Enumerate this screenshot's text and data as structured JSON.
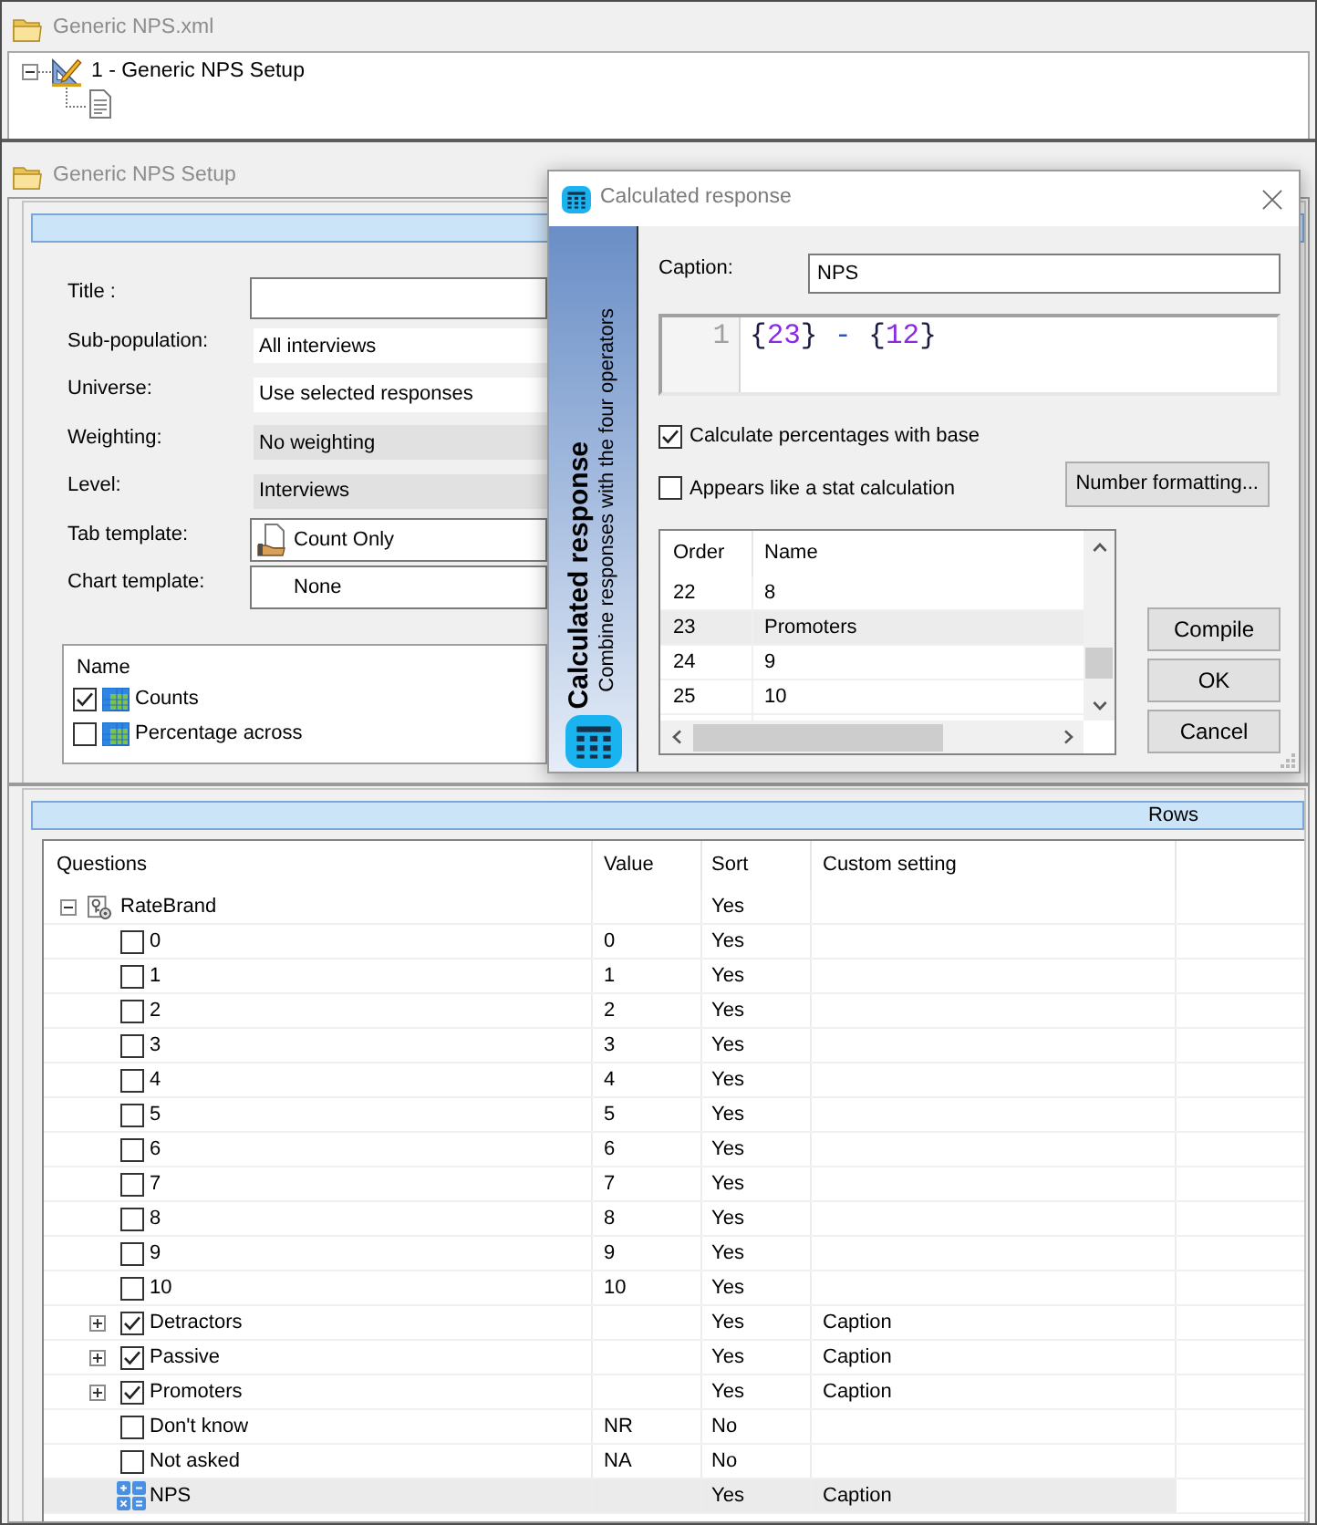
{
  "window": {
    "title": "Generic NPS.xml"
  },
  "tree": [
    {
      "kind": "setup",
      "label": "1 - Generic NPS Setup",
      "expanded": true,
      "children": [
        {
          "kind": "document"
        }
      ]
    }
  ],
  "setup": {
    "title": "Generic NPS Setup",
    "fields": [
      {
        "label": "Title :",
        "kind": "input"
      },
      {
        "label": "Sub-population:",
        "kind": "plain",
        "value": "All interviews"
      },
      {
        "label": "Universe:",
        "kind": "plain",
        "value": "Use selected responses"
      },
      {
        "label": "Weighting:",
        "kind": "readonly",
        "value": "No weighting"
      },
      {
        "label": "Level:",
        "kind": "readonly",
        "value": "Interviews"
      },
      {
        "label": "Tab template:",
        "kind": "template",
        "has_icon": true,
        "value": "Count Only"
      },
      {
        "label": "Chart template:",
        "kind": "template",
        "has_icon": false,
        "value": "None"
      }
    ],
    "table_list": {
      "column": "Name",
      "items": [
        {
          "label": "Counts",
          "checked": true
        },
        {
          "label": "Percentage across",
          "checked": false
        }
      ]
    }
  },
  "rows_section": {
    "title": "Rows",
    "columns": [
      "Questions",
      "Value",
      "Sort",
      "Custom setting"
    ],
    "rows": [
      {
        "kind": "question",
        "question": "RateBrand",
        "sort": "Yes",
        "expanded": true,
        "selected": false,
        "children": [
          {
            "kind": "response",
            "question": "0",
            "value": "0",
            "sort": "Yes",
            "checked": false,
            "selected": false
          },
          {
            "kind": "response",
            "question": "1",
            "value": "1",
            "sort": "Yes",
            "checked": false,
            "selected": false
          },
          {
            "kind": "response",
            "question": "2",
            "value": "2",
            "sort": "Yes",
            "checked": false,
            "selected": false
          },
          {
            "kind": "response",
            "question": "3",
            "value": "3",
            "sort": "Yes",
            "checked": false,
            "selected": false
          },
          {
            "kind": "response",
            "question": "4",
            "value": "4",
            "sort": "Yes",
            "checked": false,
            "selected": false
          },
          {
            "kind": "response",
            "question": "5",
            "value": "5",
            "sort": "Yes",
            "checked": false,
            "selected": false
          },
          {
            "kind": "response",
            "question": "6",
            "value": "6",
            "sort": "Yes",
            "checked": false,
            "selected": false
          },
          {
            "kind": "response",
            "question": "7",
            "value": "7",
            "sort": "Yes",
            "checked": false,
            "selected": false
          },
          {
            "kind": "response",
            "question": "8",
            "value": "8",
            "sort": "Yes",
            "checked": false,
            "selected": false
          },
          {
            "kind": "response",
            "question": "9",
            "value": "9",
            "sort": "Yes",
            "checked": false,
            "selected": false
          },
          {
            "kind": "response",
            "question": "10",
            "value": "10",
            "sort": "Yes",
            "checked": false,
            "selected": false
          },
          {
            "kind": "group",
            "question": "Detractors",
            "sort": "Yes",
            "custom_setting": "Caption",
            "checked": true,
            "expanded": false,
            "selected": false
          },
          {
            "kind": "group",
            "question": "Passive",
            "sort": "Yes",
            "custom_setting": "Caption",
            "checked": true,
            "expanded": false,
            "selected": false
          },
          {
            "kind": "group",
            "question": "Promoters",
            "sort": "Yes",
            "custom_setting": "Caption",
            "checked": true,
            "expanded": false,
            "selected": false
          },
          {
            "kind": "response",
            "question": "Don't know",
            "value": "NR",
            "sort": "No",
            "checked": false,
            "selected": false
          },
          {
            "kind": "response",
            "question": "Not asked",
            "value": "NA",
            "sort": "No",
            "checked": false,
            "selected": false
          },
          {
            "kind": "calculation",
            "question": "NPS",
            "sort": "Yes",
            "custom_setting": "Caption",
            "selected": true
          }
        ]
      }
    ]
  },
  "dialog": {
    "title": "Calculated response",
    "banner": {
      "title": "Calculated response",
      "subtitle": "Combine responses with the four operators"
    },
    "caption": {
      "label": "Caption:",
      "value": "NPS"
    },
    "code_lines": [
      {
        "number": "1",
        "text": "{23} - {12}"
      }
    ],
    "options": [
      {
        "label": "Calculate percentages with base",
        "checked": true
      },
      {
        "label": "Appears like a stat calculation",
        "checked": false
      }
    ],
    "format_button": "Number formatting...",
    "responses": {
      "columns": [
        "Order",
        "Name"
      ],
      "rows": [
        {
          "order": "22",
          "name": "8",
          "selected": false
        },
        {
          "order": "23",
          "name": "Promoters",
          "selected": true
        },
        {
          "order": "24",
          "name": "9",
          "selected": false
        },
        {
          "order": "25",
          "name": "10",
          "selected": false
        }
      ]
    },
    "buttons": [
      "Compile",
      "OK",
      "Cancel"
    ]
  }
}
